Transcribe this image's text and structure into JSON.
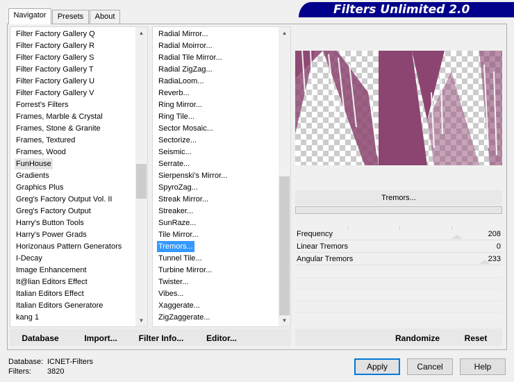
{
  "title": "Filters Unlimited 2.0",
  "tabs": [
    "Navigator",
    "Presets",
    "About"
  ],
  "categories": {
    "items": [
      "Filter Factory Gallery Q",
      "Filter Factory Gallery R",
      "Filter Factory Gallery S",
      "Filter Factory Gallery T",
      "Filter Factory Gallery U",
      "Filter Factory Gallery V",
      "Forrest's Filters",
      "Frames, Marble & Crystal",
      "Frames, Stone & Granite",
      "Frames, Textured",
      "Frames, Wood",
      "FunHouse",
      "Gradients",
      "Graphics Plus",
      "Greg's Factory Output Vol. II",
      "Greg's Factory Output",
      "Harry's Button Tools",
      "Harry's Power Grads",
      "Horizonaus Pattern Generators",
      "I-Decay",
      "Image Enhancement",
      "It@lian Editors Effect",
      "Italian Editors Effect",
      "Italian Editors Generatore",
      "kang 1"
    ],
    "selected": "FunHouse"
  },
  "filters": {
    "items": [
      "Radial Mirror...",
      "Radial Moirror...",
      "Radial Tile Mirror...",
      "Radial ZigZag...",
      "RadiaLoom...",
      "Reverb...",
      "Ring Mirror...",
      "Ring Tile...",
      "Sector Mosaic...",
      "Sectorize...",
      "Seismic...",
      "Serrate...",
      "Sierpenski's Mirror...",
      "SpyroZag...",
      "Streak Mirror...",
      "Streaker...",
      "SunRaze...",
      "Tile Mirror...",
      "Tremors...",
      "Tunnel Tile...",
      "Turbine Mirror...",
      "Twister...",
      "Vibes...",
      "Xaggerate...",
      "ZigZaggerate..."
    ],
    "selected": "Tremors..."
  },
  "filter_name": "Tremors...",
  "parameters": [
    {
      "label": "Frequency",
      "value": "208"
    },
    {
      "label": "Linear Tremors",
      "value": "0"
    },
    {
      "label": "Angular Tremors",
      "value": "233"
    }
  ],
  "buttons": {
    "database": "Database",
    "import": "Import...",
    "filter_info": "Filter Info...",
    "editor": "Editor...",
    "randomize": "Randomize",
    "reset": "Reset",
    "apply": "Apply",
    "cancel": "Cancel",
    "help": "Help"
  },
  "status": {
    "database_label": "Database:",
    "database_value": "ICNET-Filters",
    "filters_label": "Filters:",
    "filters_value": "3820"
  },
  "colors": {
    "banner": "#00008b",
    "preview_fill": "#8b4570",
    "selection": "#3399ff"
  }
}
